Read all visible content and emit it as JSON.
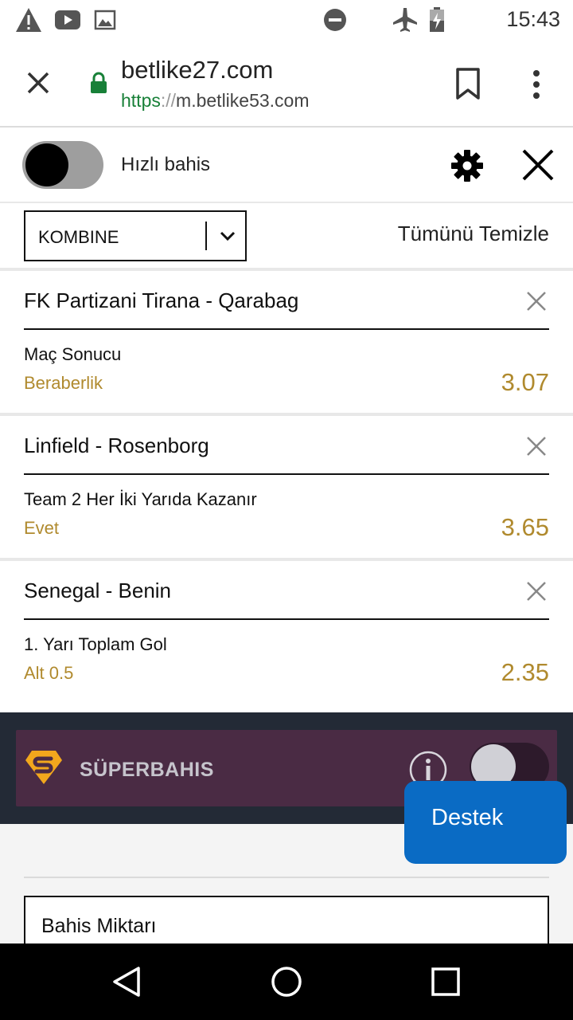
{
  "status_bar": {
    "time": "15:43",
    "icons": [
      "warning-icon",
      "youtube-icon",
      "image-icon",
      "do-not-disturb-icon",
      "airplane-mode-icon",
      "battery-charging-icon"
    ]
  },
  "browser": {
    "title": "betlike27.com",
    "url_scheme": "https",
    "url_separator": "://",
    "url_host": "m.betlike53.com",
    "icons": [
      "close-icon",
      "lock-icon",
      "bookmark-icon",
      "more-vert-icon"
    ]
  },
  "quick_bet": {
    "label": "Hızlı bahis",
    "enabled": false
  },
  "bet_type": {
    "selected": "KOMBINE",
    "clear_all_label": "Tümünü Temizle"
  },
  "bets": [
    {
      "match": "FK Partizani Tirana - Qarabag",
      "market": "Maç Sonucu",
      "selection": "Beraberlik",
      "odds": "3.07"
    },
    {
      "match": "Linfield - Rosenborg",
      "market": "Team 2 Her İki Yarıda Kazanır",
      "selection": "Evet",
      "odds": "3.65"
    },
    {
      "match": "Senegal - Benin",
      "market": "1. Yarı Toplam Gol",
      "selection": "Alt 0.5",
      "odds": "2.35"
    }
  ],
  "superbahis": {
    "label": "SÜPERBAHIS",
    "enabled": false
  },
  "stake": {
    "label": "Bahis Miktarı"
  },
  "support": {
    "label": "Destek"
  },
  "colors": {
    "accent_gold": "#b08a2e",
    "support_blue": "#0a6bc4",
    "superbahis_bg": "#4a2b44",
    "url_green": "#188038"
  }
}
